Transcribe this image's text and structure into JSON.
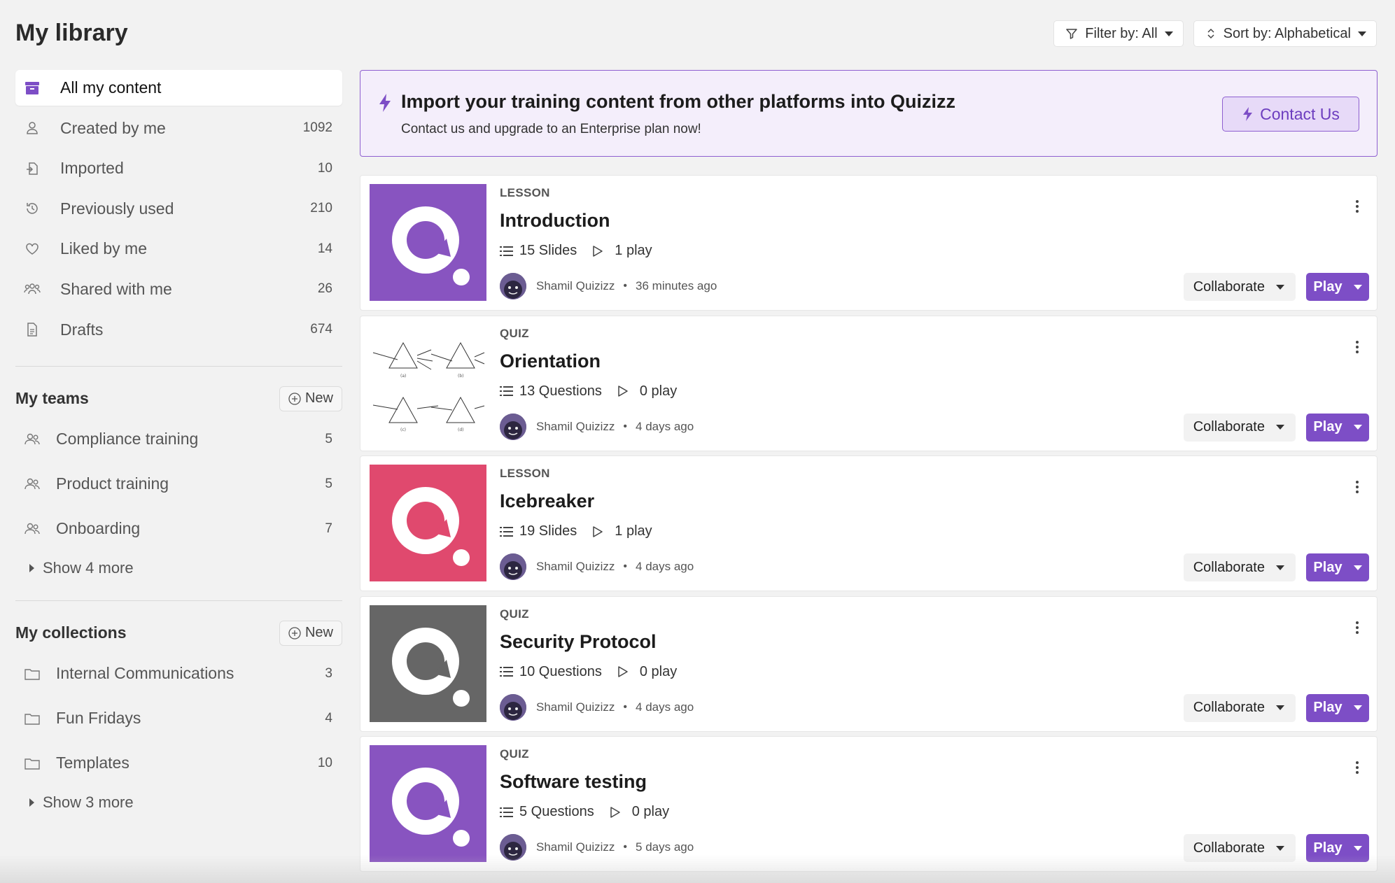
{
  "page": {
    "title": "My library"
  },
  "toolbar": {
    "filter_label": "Filter by: All",
    "sort_label": "Sort by: Alphabetical"
  },
  "sidebar": {
    "items": [
      {
        "label": "All my content",
        "count": "",
        "icon": "archive-icon"
      },
      {
        "label": "Created by me",
        "count": "1092",
        "icon": "user-icon"
      },
      {
        "label": "Imported",
        "count": "10",
        "icon": "import-icon"
      },
      {
        "label": "Previously used",
        "count": "210",
        "icon": "history-icon"
      },
      {
        "label": "Liked by me",
        "count": "14",
        "icon": "heart-icon"
      },
      {
        "label": "Shared with me",
        "count": "26",
        "icon": "users-icon"
      },
      {
        "label": "Drafts",
        "count": "674",
        "icon": "document-icon"
      }
    ],
    "teams": {
      "title": "My teams",
      "new_label": "New",
      "items": [
        {
          "label": "Compliance training",
          "count": "5"
        },
        {
          "label": "Product training",
          "count": "5"
        },
        {
          "label": "Onboarding",
          "count": "7"
        }
      ],
      "show_more": "Show 4 more"
    },
    "collections": {
      "title": "My collections",
      "new_label": "New",
      "items": [
        {
          "label": "Internal Communications",
          "count": "3"
        },
        {
          "label": "Fun Fridays",
          "count": "4"
        },
        {
          "label": "Templates",
          "count": "10"
        }
      ],
      "show_more": "Show 3 more"
    }
  },
  "banner": {
    "title": "Import your training content from other platforms into Quizizz",
    "subtitle": "Contact us and upgrade to an Enterprise plan now!",
    "button_label": "Contact Us"
  },
  "cards": [
    {
      "kind": "LESSON",
      "title": "Introduction",
      "count_label": "15 Slides",
      "plays": "1 play",
      "author": "Shamil Quizizz",
      "time": "36 minutes ago",
      "thumb_color": "#8854c0",
      "thumb_type": "logo"
    },
    {
      "kind": "QUIZ",
      "title": "Orientation",
      "count_label": "13 Questions",
      "plays": "0 play",
      "author": "Shamil Quizizz",
      "time": "4 days ago",
      "thumb_color": "#ffffff",
      "thumb_type": "prisms"
    },
    {
      "kind": "LESSON",
      "title": "Icebreaker",
      "count_label": "19 Slides",
      "plays": "1 play",
      "author": "Shamil Quizizz",
      "time": "4 days ago",
      "thumb_color": "#e0496e",
      "thumb_type": "logo"
    },
    {
      "kind": "QUIZ",
      "title": "Security Protocol",
      "count_label": "10 Questions",
      "plays": "0 play",
      "author": "Shamil Quizizz",
      "time": "4 days ago",
      "thumb_color": "#666666",
      "thumb_type": "logo"
    },
    {
      "kind": "QUIZ",
      "title": "Software testing",
      "count_label": "5 Questions",
      "plays": "0 play",
      "author": "Shamil Quizizz",
      "time": "5 days ago",
      "thumb_color": "#8854c0",
      "thumb_type": "logo"
    }
  ],
  "card_actions": {
    "collaborate_label": "Collaborate",
    "play_label": "Play"
  },
  "colors": {
    "accent": "#7d4ec6",
    "banner_bg": "#f4eefb",
    "page_bg": "#f2f2f2"
  }
}
